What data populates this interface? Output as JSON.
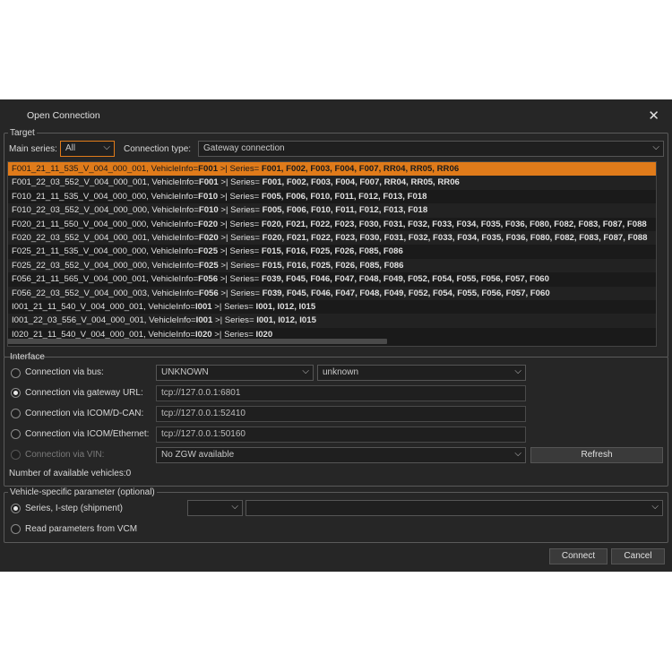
{
  "window": {
    "title": "Open Connection",
    "close_glyph": "✕"
  },
  "target": {
    "legend": "Target",
    "main_series_label": "Main series:",
    "main_series_value": "All",
    "connection_type_label": "Connection type:",
    "connection_type_value": "Gateway connection",
    "rows": [
      {
        "prefix": "F001_21_11_535_V_004_000_001, VehicleInfo=",
        "info": "F001",
        "mid": " >| Series= ",
        "series": "F001, F002, F003, F004, F007, RR04, RR05, RR06",
        "selected": true
      },
      {
        "prefix": "F001_22_03_552_V_004_000_001, VehicleInfo=",
        "info": "F001",
        "mid": " >| Series= ",
        "series": "F001, F002, F003, F004, F007, RR04, RR05, RR06"
      },
      {
        "prefix": "F010_21_11_535_V_004_000_000, VehicleInfo=",
        "info": "F010",
        "mid": " >| Series= ",
        "series": "F005, F006, F010, F011, F012, F013, F018"
      },
      {
        "prefix": "F010_22_03_552_V_004_000_000, VehicleInfo=",
        "info": "F010",
        "mid": " >| Series= ",
        "series": "F005, F006, F010, F011, F012, F013, F018"
      },
      {
        "prefix": "F020_21_11_550_V_004_000_000, VehicleInfo=",
        "info": "F020",
        "mid": " >| Series= ",
        "series": "F020, F021, F022, F023, F030, F031, F032, F033, F034, F035, F036, F080, F082, F083, F087, F088"
      },
      {
        "prefix": "F020_22_03_552_V_004_000_001, VehicleInfo=",
        "info": "F020",
        "mid": " >| Series= ",
        "series": "F020, F021, F022, F023, F030, F031, F032, F033, F034, F035, F036, F080, F082, F083, F087, F088"
      },
      {
        "prefix": "F025_21_11_535_V_004_000_000, VehicleInfo=",
        "info": "F025",
        "mid": " >| Series= ",
        "series": "F015, F016, F025, F026, F085, F086"
      },
      {
        "prefix": "F025_22_03_552_V_004_000_000, VehicleInfo=",
        "info": "F025",
        "mid": " >| Series= ",
        "series": "F015, F016, F025, F026, F085, F086"
      },
      {
        "prefix": "F056_21_11_565_V_004_000_001, VehicleInfo=",
        "info": "F056",
        "mid": " >| Series= ",
        "series": "F039, F045, F046, F047, F048, F049, F052, F054, F055, F056, F057, F060"
      },
      {
        "prefix": "F056_22_03_552_V_004_000_003, VehicleInfo=",
        "info": "F056",
        "mid": " >| Series= ",
        "series": "F039, F045, F046, F047, F048, F049, F052, F054, F055, F056, F057, F060"
      },
      {
        "prefix": "I001_21_11_540_V_004_000_001, VehicleInfo=",
        "info": "I001",
        "mid": " >| Series= ",
        "series": "I001, I012, I015"
      },
      {
        "prefix": "I001_22_03_556_V_004_000_001, VehicleInfo=",
        "info": "I001",
        "mid": " >| Series= ",
        "series": "I001, I012, I015"
      },
      {
        "prefix": "I020_21_11_540_V_004_000_001, VehicleInfo=",
        "info": "I020",
        "mid": " >| Series= ",
        "series": "I020"
      }
    ]
  },
  "interface": {
    "legend": "Interface",
    "bus": {
      "label": "Connection via bus:",
      "value1": "UNKNOWN",
      "value2": "unknown"
    },
    "gateway": {
      "label": "Connection via gateway URL:",
      "value": "tcp://127.0.0.1:6801"
    },
    "icom_dcan": {
      "label": "Connection via ICOM/D-CAN:",
      "value": "tcp://127.0.0.1:52410"
    },
    "icom_eth": {
      "label": "Connection via ICOM/Ethernet:",
      "value": "tcp://127.0.0.1:50160"
    },
    "vin": {
      "label": "Connection via VIN:",
      "value": "No ZGW available"
    },
    "refresh_label": "Refresh",
    "vehicles_count": "Number of available vehicles:0"
  },
  "vehicle_params": {
    "legend": "Vehicle-specific parameter (optional)",
    "series_istep_label": "Series, I-step (shipment)",
    "read_vcm_label": "Read parameters from VCM"
  },
  "footer": {
    "connect_label": "Connect",
    "cancel_label": "Cancel"
  },
  "colors": {
    "accent": "#e07b1a",
    "background": "#262626"
  },
  "icons": {
    "dropdown": "chevron-down-icon",
    "close": "close-icon"
  }
}
